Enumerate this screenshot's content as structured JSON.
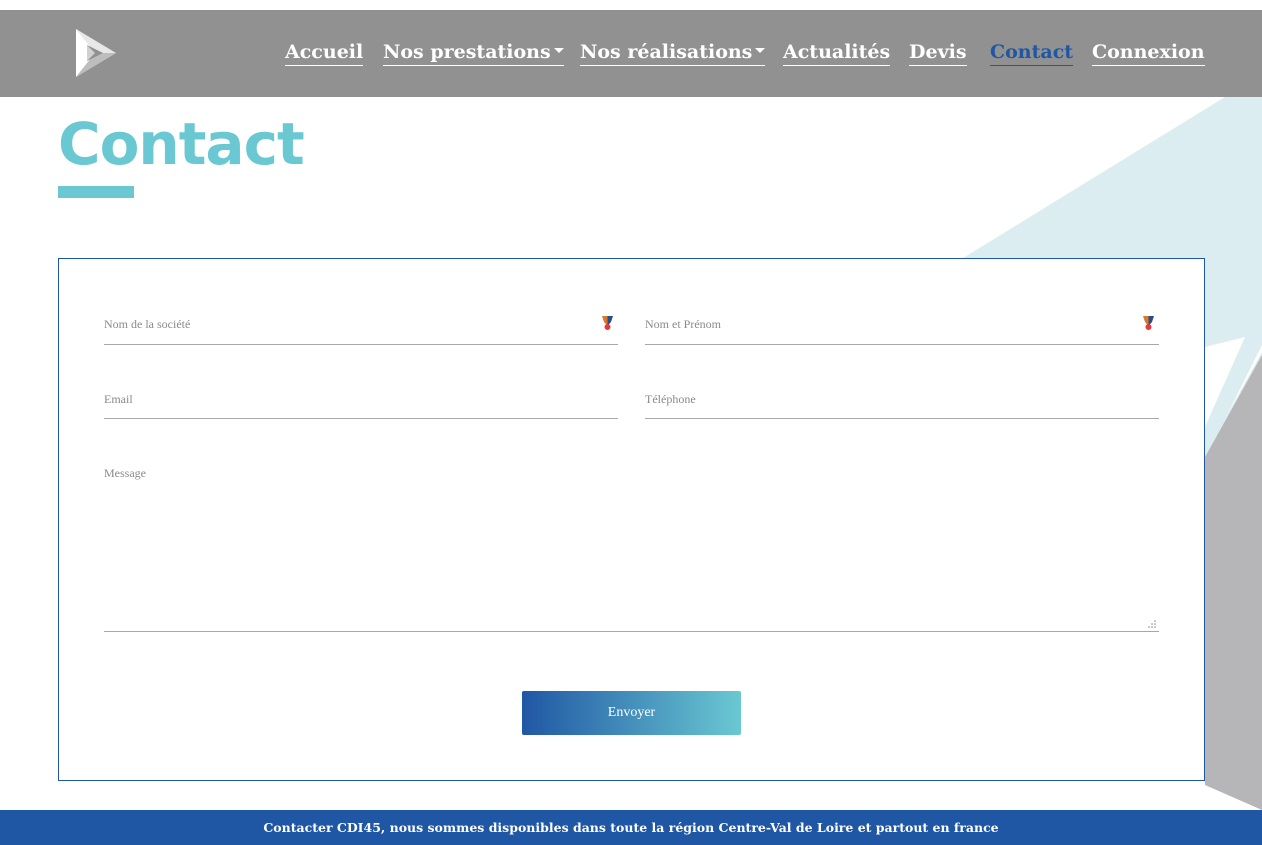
{
  "header": {
    "nav": [
      {
        "label": "Accueil",
        "has_dropdown": false,
        "active": false
      },
      {
        "label": "Nos prestations",
        "has_dropdown": true,
        "active": false
      },
      {
        "label": "Nos réalisations",
        "has_dropdown": true,
        "active": false
      },
      {
        "label": "Actualités",
        "has_dropdown": false,
        "active": false
      },
      {
        "label": "Devis",
        "has_dropdown": false,
        "active": false
      },
      {
        "label": "Contact",
        "has_dropdown": false,
        "active": true
      },
      {
        "label": "Connexion",
        "has_dropdown": false,
        "active": false
      }
    ]
  },
  "page": {
    "title": "Contact"
  },
  "form": {
    "company": {
      "placeholder": "Nom de la société",
      "value": ""
    },
    "name": {
      "placeholder": "Nom et Prénom",
      "value": ""
    },
    "email": {
      "placeholder": "Email",
      "value": ""
    },
    "phone": {
      "placeholder": "Téléphone",
      "value": ""
    },
    "message": {
      "placeholder": "Message",
      "value": ""
    },
    "submit_label": "Envoyer"
  },
  "footer": {
    "text": "Contacter CDI45, nous sommes disponibles dans toute la région Centre-Val de Loire et partout en france"
  },
  "colors": {
    "header_bg": "#919191",
    "accent_teal": "#6ac8d2",
    "brand_blue": "#2057a4",
    "active_nav": "#2057a4"
  },
  "icons": {
    "logo": "triangle-logo-icon",
    "field_extension": "autofill-extension-icon",
    "dropdown": "caret-down-icon",
    "textarea_resize": "resize-handle-icon"
  }
}
